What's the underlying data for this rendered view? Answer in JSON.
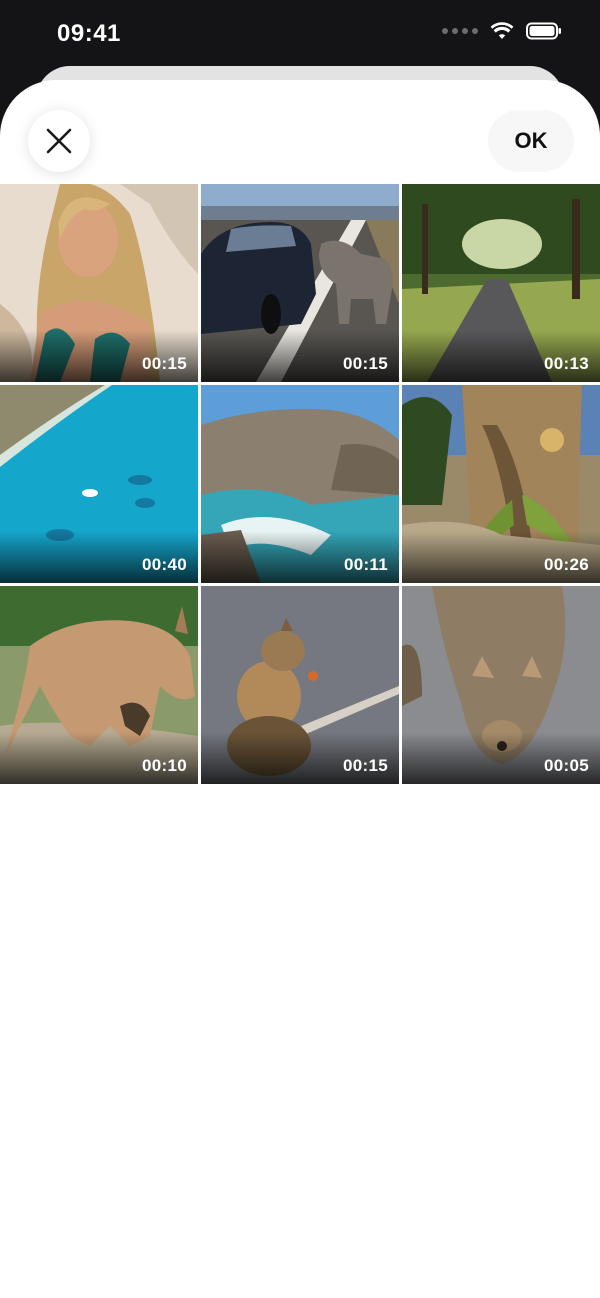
{
  "status_bar": {
    "time": "09:41",
    "icons": [
      "signal-icon",
      "wifi-icon",
      "battery-icon"
    ]
  },
  "header": {
    "close_icon": "close-icon",
    "ok_label": "OK"
  },
  "videos": [
    {
      "duration": "00:15",
      "subject": "woman-selfie-beach"
    },
    {
      "duration": "00:15",
      "subject": "car-and-donkey-road"
    },
    {
      "duration": "00:13",
      "subject": "tree-lined-path"
    },
    {
      "duration": "00:40",
      "subject": "turquoise-sea-aerial"
    },
    {
      "duration": "00:11",
      "subject": "rocky-cove"
    },
    {
      "duration": "00:26",
      "subject": "palm-tree"
    },
    {
      "duration": "00:10",
      "subject": "kangaroo"
    },
    {
      "duration": "00:15",
      "subject": "quokkas-eating"
    },
    {
      "duration": "00:05",
      "subject": "quokka-closeup"
    }
  ],
  "colors": {
    "status_bar_bg": "#141416",
    "sheet_bg": "#ffffff",
    "back_card": "#e3e3e3"
  }
}
